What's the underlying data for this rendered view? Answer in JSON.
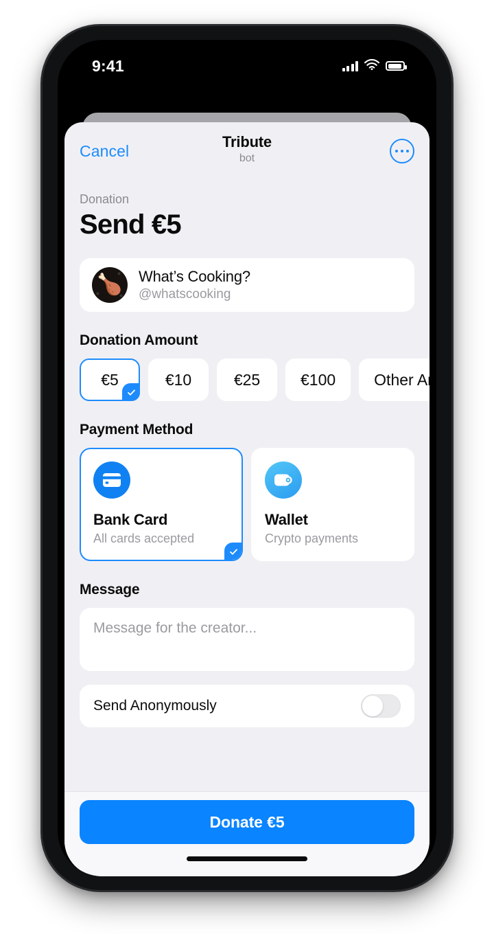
{
  "status_bar": {
    "time": "9:41",
    "cellular_icon": "signal-bars-icon",
    "wifi_icon": "wifi-icon",
    "battery_icon": "battery-icon"
  },
  "nav": {
    "cancel_label": "Cancel",
    "title": "Tribute",
    "subtitle": "bot",
    "more_icon": "more-dots-icon"
  },
  "header": {
    "eyebrow": "Donation",
    "headline": "Send €5"
  },
  "creator": {
    "avatar_emoji": "🍗",
    "avatar_icon": "roast-poultry-avatar",
    "name": "What’s Cooking?",
    "handle": "@whatscooking"
  },
  "amount_section": {
    "title": "Donation Amount",
    "selected_index": 0,
    "options": [
      {
        "label": "€5",
        "selected": true
      },
      {
        "label": "€10",
        "selected": false
      },
      {
        "label": "€25",
        "selected": false
      },
      {
        "label": "€100",
        "selected": false
      },
      {
        "label": "Other Amount",
        "selected": false
      }
    ]
  },
  "payment_section": {
    "title": "Payment Method",
    "methods": [
      {
        "title": "Bank Card",
        "subtitle": "All cards accepted",
        "icon": "credit-card-icon",
        "selected": true
      },
      {
        "title": "Wallet",
        "subtitle": "Crypto payments",
        "icon": "wallet-icon",
        "selected": false
      }
    ]
  },
  "message_section": {
    "title": "Message",
    "placeholder": "Message for the creator...",
    "value": ""
  },
  "anonymous_row": {
    "label": "Send Anonymously",
    "enabled": false
  },
  "footer": {
    "donate_label": "Donate €5"
  },
  "colors": {
    "accent": "#1d8bfc",
    "donate_button": "#0a84ff",
    "sheet_background": "#f0f0f4",
    "card_background": "#ffffff",
    "muted_text": "#9a9aa0"
  }
}
